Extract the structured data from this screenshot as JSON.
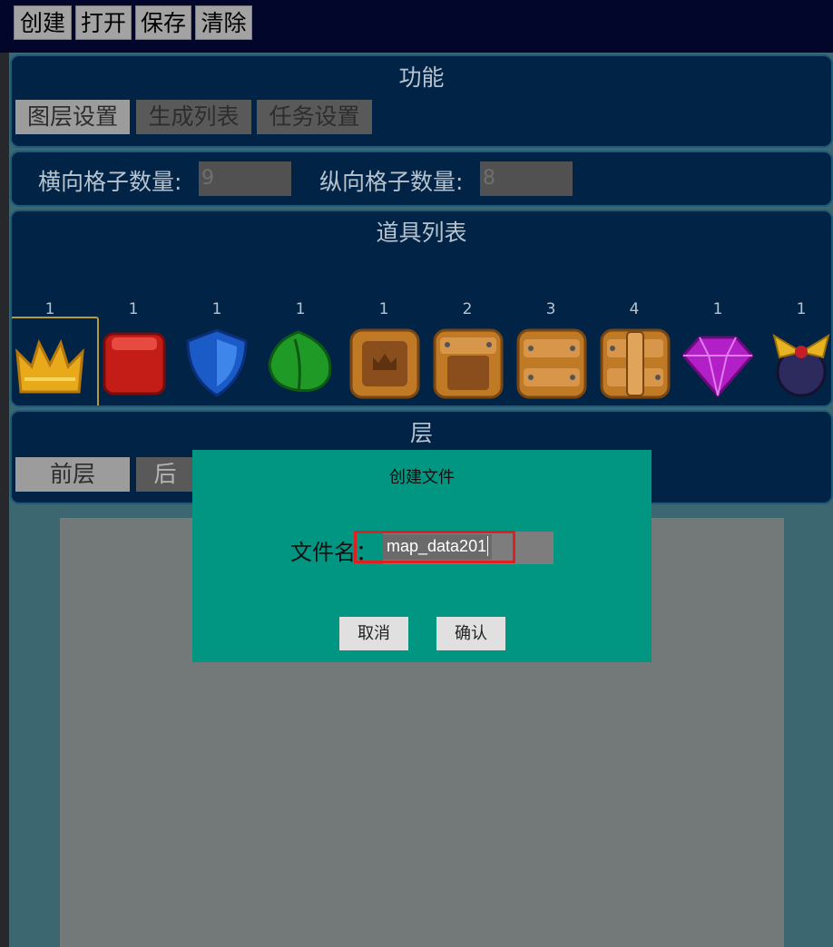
{
  "toolbar": {
    "buttons": [
      "创建",
      "打开",
      "保存",
      "清除"
    ]
  },
  "functions": {
    "title": "功能",
    "tabs": [
      "图层设置",
      "生成列表",
      "任务设置"
    ]
  },
  "grid": {
    "h_label": "横向格子数量:",
    "h_value": "9",
    "v_label": "纵向格子数量:",
    "v_value": "8"
  },
  "items": {
    "title": "道具列表",
    "list": [
      {
        "count": "1",
        "icon": "crown-icon"
      },
      {
        "count": "1",
        "icon": "red-cube-icon"
      },
      {
        "count": "1",
        "icon": "shield-icon"
      },
      {
        "count": "1",
        "icon": "leaf-icon"
      },
      {
        "count": "1",
        "icon": "wooden-crate-1-icon"
      },
      {
        "count": "2",
        "icon": "wooden-crate-2-icon"
      },
      {
        "count": "3",
        "icon": "wooden-crate-3-icon"
      },
      {
        "count": "4",
        "icon": "wooden-crate-4-icon"
      },
      {
        "count": "1",
        "icon": "purple-gem-icon"
      },
      {
        "count": "1",
        "icon": "propeller-bomb-icon"
      }
    ]
  },
  "layers": {
    "title": "层",
    "front": "前层",
    "back_partial": "后"
  },
  "dialog": {
    "title": "创建文件",
    "label": "文件名：",
    "filename": "map_data201",
    "cancel": "取消",
    "confirm": "确认"
  },
  "colors": {
    "panel_bg": "#002346",
    "dialog_bg": "#009682",
    "highlight": "#e02020"
  }
}
